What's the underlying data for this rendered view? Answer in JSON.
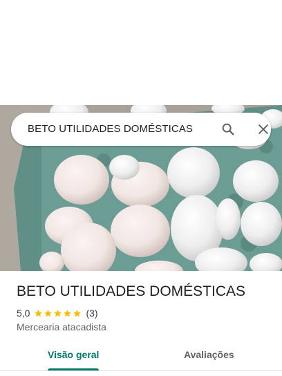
{
  "search": {
    "query": "BETO UTILIDADES DOMÉSTICAS",
    "search_icon": "search-icon",
    "close_icon": "close-icon"
  },
  "photo": {
    "subject_icon": "eggs-photo"
  },
  "place": {
    "name": "BETO UTILIDADES DOMÉSTICAS",
    "rating": "5,0",
    "stars": 5,
    "review_count": "(3)",
    "category": "Mercearia atacadista"
  },
  "tabs": [
    {
      "label": "Visão geral",
      "active": true
    },
    {
      "label": "Avaliações",
      "active": false
    }
  ],
  "colors": {
    "accent": "#00796b",
    "star": "#fbbc04"
  }
}
